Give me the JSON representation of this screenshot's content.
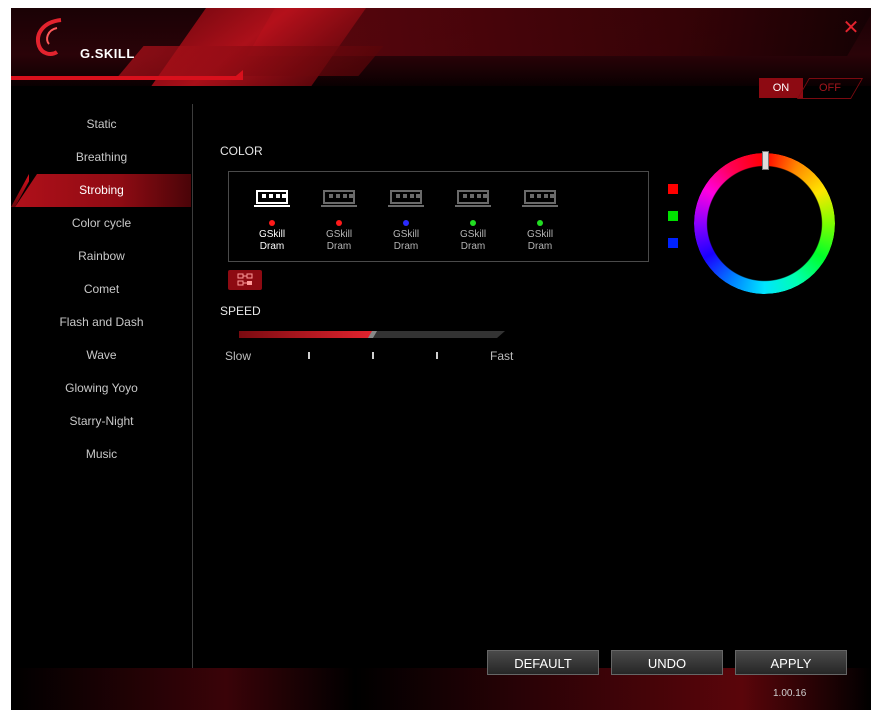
{
  "app": {
    "logo_text": "G.SKILL",
    "close_icon": "close-icon"
  },
  "toggle": {
    "on_label": "ON",
    "off_label": "OFF"
  },
  "modes": [
    {
      "label": "Static",
      "active": false
    },
    {
      "label": "Breathing",
      "active": false
    },
    {
      "label": "Strobing",
      "active": true
    },
    {
      "label": "Color cycle",
      "active": false
    },
    {
      "label": "Rainbow",
      "active": false
    },
    {
      "label": "Comet",
      "active": false
    },
    {
      "label": "Flash and Dash",
      "active": false
    },
    {
      "label": "Wave",
      "active": false
    },
    {
      "label": "Glowing Yoyo",
      "active": false
    },
    {
      "label": "Starry-Night",
      "active": false
    },
    {
      "label": "Music",
      "active": false
    }
  ],
  "color_section": {
    "label": "COLOR"
  },
  "devices": [
    {
      "name1": "GSkill",
      "name2": "Dram",
      "dot_color": "#ff1a1a",
      "selected": true
    },
    {
      "name1": "GSkill",
      "name2": "Dram",
      "dot_color": "#ff1a1a",
      "selected": false
    },
    {
      "name1": "GSkill",
      "name2": "Dram",
      "dot_color": "#2a2aff",
      "selected": false
    },
    {
      "name1": "GSkill",
      "name2": "Dram",
      "dot_color": "#22dd22",
      "selected": false
    },
    {
      "name1": "GSkill",
      "name2": "Dram",
      "dot_color": "#22dd22",
      "selected": false
    }
  ],
  "speed_section": {
    "label": "SPEED",
    "slow_label": "Slow",
    "fast_label": "Fast",
    "level": 0.5
  },
  "swatches": [
    {
      "name": "red",
      "color": "#ff0000"
    },
    {
      "name": "green",
      "color": "#00e000"
    },
    {
      "name": "blue",
      "color": "#0022ff"
    }
  ],
  "buttons": {
    "default_label": "DEFAULT",
    "undo_label": "UNDO",
    "apply_label": "APPLY"
  },
  "version": "1.00.16",
  "accent_color": "#d8101c"
}
